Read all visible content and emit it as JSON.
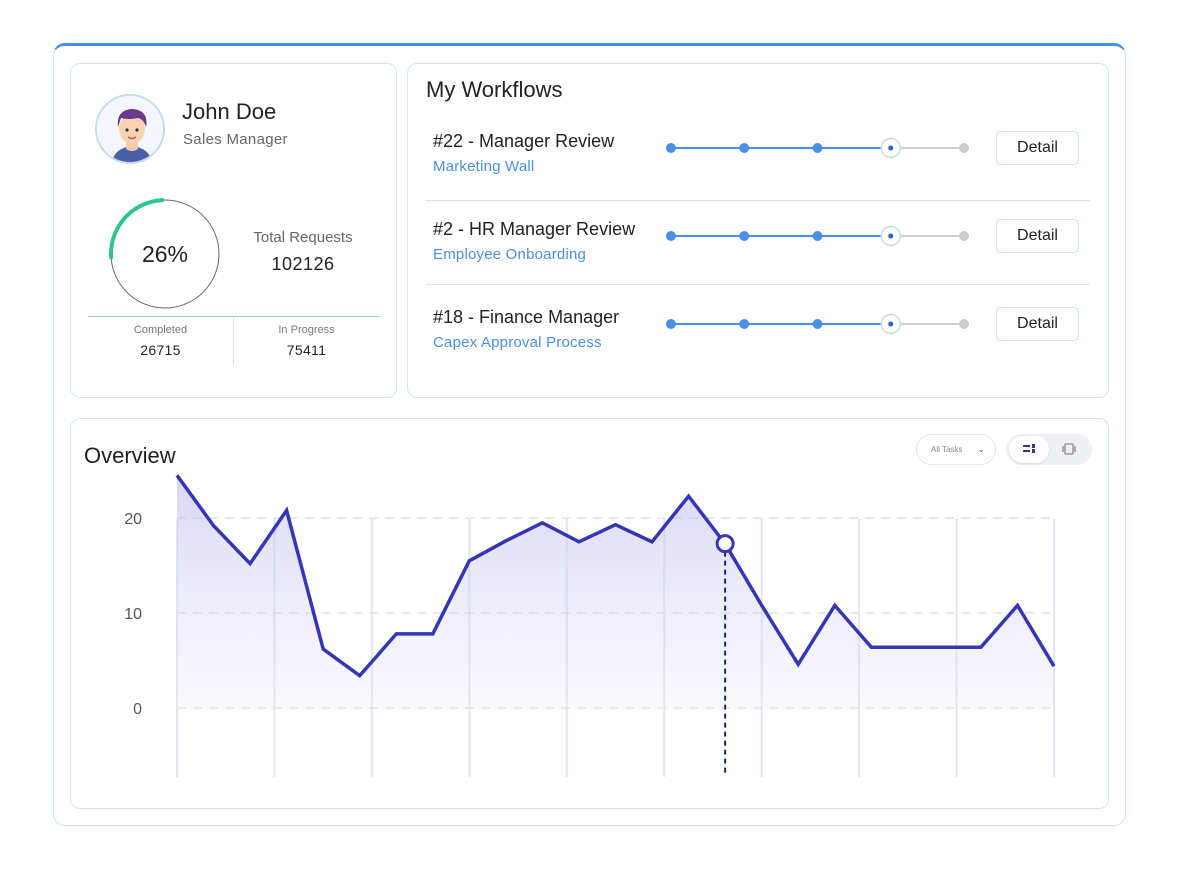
{
  "profile": {
    "name": "John Doe",
    "role": "Sales Manager",
    "completion_percent": 26,
    "completion_label": "26%",
    "total_requests_label": "Total Requests",
    "total_requests": "102126",
    "completed_label": "Completed",
    "completed": "26715",
    "in_progress_label": "In Progress",
    "in_progress": "75411"
  },
  "workflows": {
    "title": "My Workflows",
    "detail_label": "Detail",
    "items": [
      {
        "name": "#22 - Manager Review",
        "process": "Marketing Wall",
        "total_steps": 5,
        "current_step": 4
      },
      {
        "name": "#2 - HR Manager Review",
        "process": "Employee Onboarding",
        "total_steps": 5,
        "current_step": 4
      },
      {
        "name": "#18 - Finance Manager",
        "process": "Capex Approval Process",
        "total_steps": 5,
        "current_step": 4
      }
    ]
  },
  "overview": {
    "title": "Overview",
    "filter_value": "All Tasks",
    "icons": {
      "filter_chevron": "chevron-down-icon",
      "view_a": "list-view-icon",
      "view_b": "card-view-icon"
    },
    "colors": {
      "line": "#3535b5",
      "accent": "#4a8fdb",
      "gauge": "#2ec58c",
      "step_done": "#4a8fe8",
      "step_todo": "#cccccc"
    }
  },
  "chart_data": {
    "type": "area",
    "ylabel": "",
    "xlabel": "",
    "y_ticks": [
      0,
      10,
      20
    ],
    "ylim": [
      0,
      22
    ],
    "grid": true,
    "series": [
      {
        "values": [
          24.5,
          19.2,
          15.2,
          20.8,
          6.2,
          3.4,
          7.8,
          7.8,
          15.5,
          17.6,
          19.5,
          17.5,
          19.3,
          17.5,
          22.3,
          17.3,
          10.8,
          4.6,
          10.8,
          6.4,
          6.4,
          6.4,
          6.4,
          10.8,
          4.4
        ]
      }
    ],
    "highlight_index": 15
  }
}
